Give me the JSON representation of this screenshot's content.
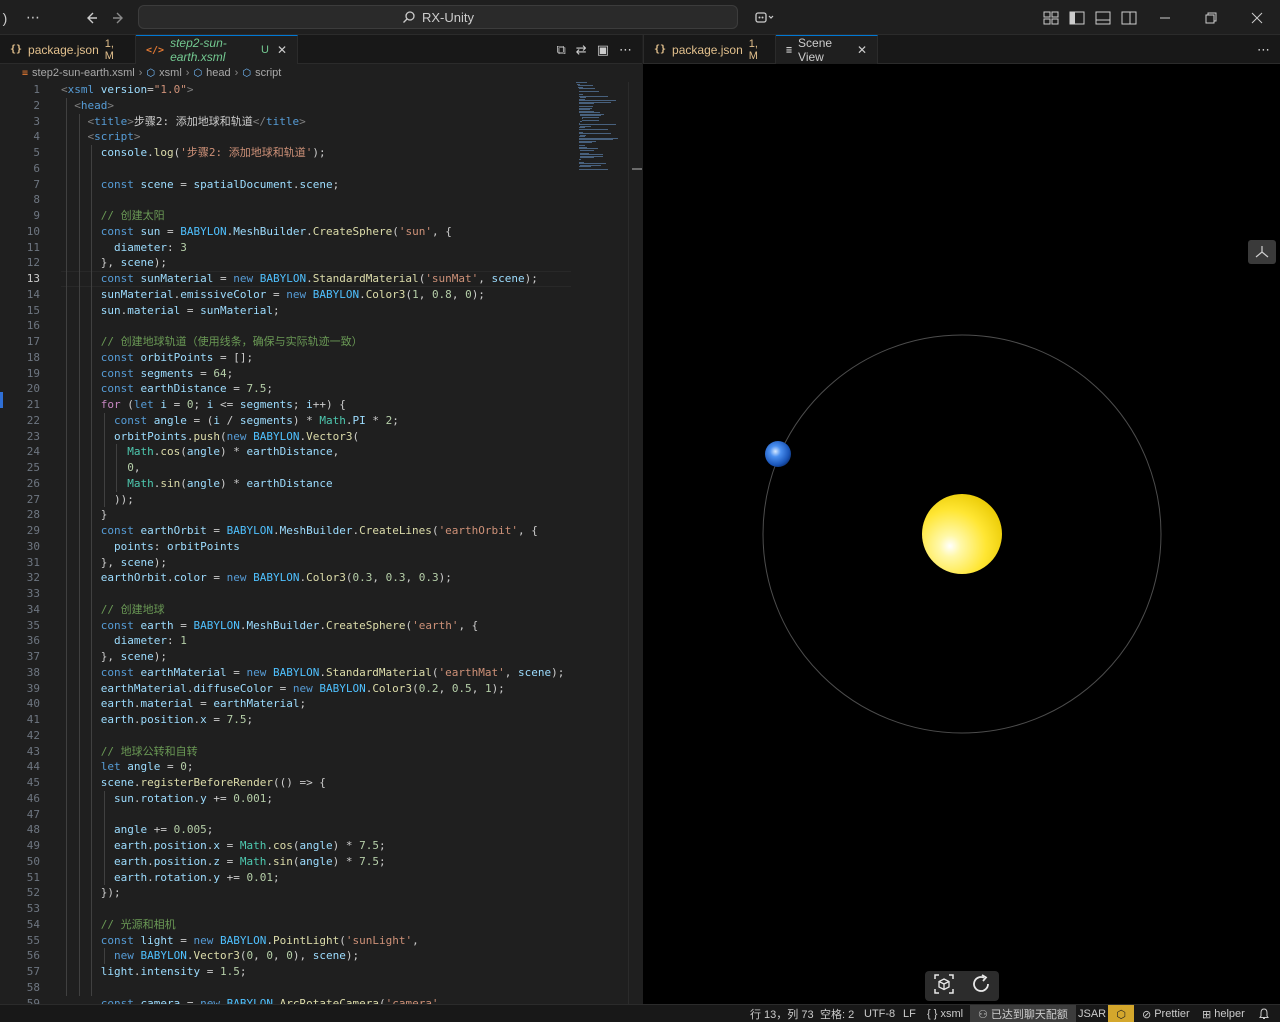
{
  "titlebar": {
    "search_text": "RX-Unity",
    "menu_icon": "ellipsis-icon",
    "back_icon": "arrow-left-icon",
    "forward_icon": "arrow-right-icon",
    "copilot_icon": "copilot-icon"
  },
  "left_tabs": [
    {
      "icon": "{}",
      "label": "package.json",
      "status": "1, M"
    },
    {
      "icon": "</>",
      "label": "step2-sun-earth.xsml",
      "status": "U"
    }
  ],
  "right_tabs": [
    {
      "icon": "{}",
      "label": "package.json",
      "status": "1, M"
    },
    {
      "icon": "≡",
      "label": "Scene View"
    }
  ],
  "breadcrumb": [
    "step2-sun-earth.xsml",
    "xsml",
    "head",
    "script"
  ],
  "code": {
    "current_line": 13,
    "lines": [
      "<xsml version=\"1.0\">",
      "  <head>",
      "    <title>步骤2: 添加地球和轨道</title>",
      "    <script>",
      "      console.log('步骤2: 添加地球和轨道');",
      "",
      "      const scene = spatialDocument.scene;",
      "",
      "      // 创建太阳",
      "      const sun = BABYLON.MeshBuilder.CreateSphere('sun', {",
      "        diameter: 3",
      "      }, scene);",
      "      const sunMaterial = new BABYLON.StandardMaterial('sunMat', scene);",
      "      sunMaterial.emissiveColor = new BABYLON.Color3(1, 0.8, 0);",
      "      sun.material = sunMaterial;",
      "",
      "      // 创建地球轨道（使用线条，确保与实际轨迹一致）",
      "      const orbitPoints = [];",
      "      const segments = 64;",
      "      const earthDistance = 7.5;",
      "      for (let i = 0; i <= segments; i++) {",
      "        const angle = (i / segments) * Math.PI * 2;",
      "        orbitPoints.push(new BABYLON.Vector3(",
      "          Math.cos(angle) * earthDistance,",
      "          0,",
      "          Math.sin(angle) * earthDistance",
      "        ));",
      "      }",
      "      const earthOrbit = BABYLON.MeshBuilder.CreateLines('earthOrbit', {",
      "        points: orbitPoints",
      "      }, scene);",
      "      earthOrbit.color = new BABYLON.Color3(0.3, 0.3, 0.3);",
      "",
      "      // 创建地球",
      "      const earth = BABYLON.MeshBuilder.CreateSphere('earth', {",
      "        diameter: 1",
      "      }, scene);",
      "      const earthMaterial = new BABYLON.StandardMaterial('earthMat', scene);",
      "      earthMaterial.diffuseColor = new BABYLON.Color3(0.2, 0.5, 1);",
      "      earth.material = earthMaterial;",
      "      earth.position.x = 7.5;",
      "",
      "      // 地球公转和自转",
      "      let angle = 0;",
      "      scene.registerBeforeRender(() => {",
      "        sun.rotation.y += 0.001;",
      "",
      "        angle += 0.005;",
      "        earth.position.x = Math.cos(angle) * 7.5;",
      "        earth.position.z = Math.sin(angle) * 7.5;",
      "        earth.rotation.y += 0.01;",
      "      });",
      "",
      "      // 光源和相机",
      "      const light = new BABYLON.PointLight('sunLight',",
      "        new BABYLON.Vector3(0, 0, 0), scene);",
      "      light.intensity = 1.5;",
      "",
      "      const camera = new BABYLON.ArcRotateCamera('camera',"
    ]
  },
  "scene": {
    "axis_icon": "axes-icon",
    "toolbar": [
      "focus-cube-icon",
      "refresh-icon"
    ],
    "colors": {
      "sun": "#ffe633",
      "earth": "#2a73e0",
      "orbit": "#4d4d4d"
    }
  },
  "statusbar": {
    "position": "行 13，列 73",
    "spaces": "空格: 2",
    "encoding": "UTF-8",
    "eol": "LF",
    "language": "{ } xsml",
    "chat": "已达到聊天配额",
    "jsar": "JSAR",
    "prettier": "Prettier",
    "helper": "helper"
  }
}
